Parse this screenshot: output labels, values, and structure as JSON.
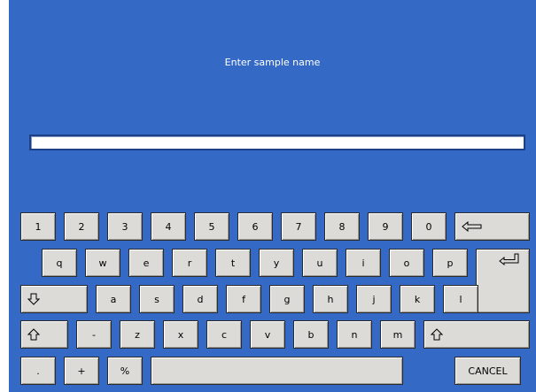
{
  "prompt": "Enter sample name",
  "input": {
    "value": ""
  },
  "keys": {
    "n1": "1",
    "n2": "2",
    "n3": "3",
    "n4": "4",
    "n5": "5",
    "n6": "6",
    "n7": "7",
    "n8": "8",
    "n9": "9",
    "n0": "0",
    "q": "q",
    "w": "w",
    "e": "e",
    "r": "r",
    "t": "t",
    "y": "y",
    "u": "u",
    "i": "i",
    "o": "o",
    "p": "p",
    "a": "a",
    "s": "s",
    "d": "d",
    "f": "f",
    "g": "g",
    "h": "h",
    "j": "j",
    "k": "k",
    "l": "l",
    "dash": "-",
    "z": "z",
    "x": "x",
    "c": "c",
    "v": "v",
    "b": "b",
    "n": "n",
    "m": "m",
    "dot": ".",
    "plus": "+",
    "percent": "%",
    "cancel": "CANCEL"
  },
  "icons": {
    "backspace": "backspace-arrow-icon",
    "enter": "enter-arrow-icon",
    "caps": "caps-lock-arrow-icon",
    "shift_left": "shift-arrow-icon",
    "shift_right": "shift-arrow-icon"
  }
}
